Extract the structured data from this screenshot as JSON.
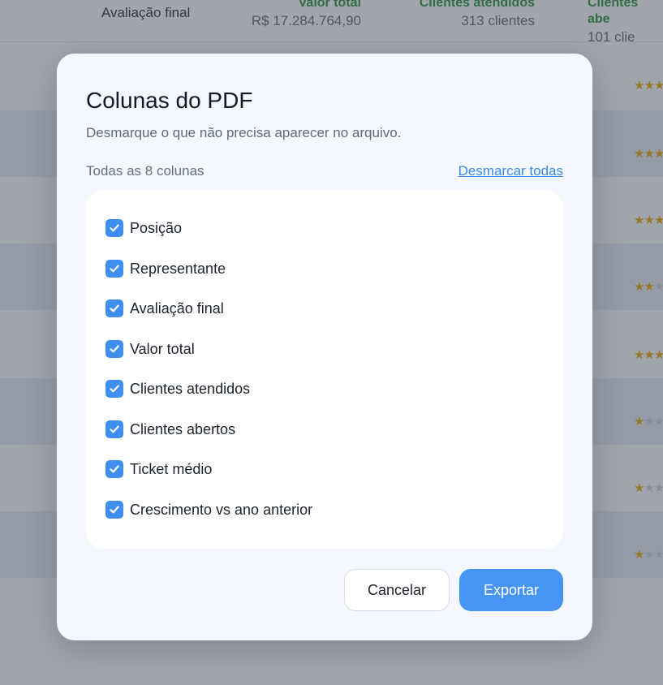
{
  "background_table": {
    "header": {
      "title": "Avaliação final",
      "columns": [
        {
          "label": "Valor total",
          "value": "R$ 17.284.764,90"
        },
        {
          "label": "Clientes atendidos",
          "value": "313 clientes"
        },
        {
          "label": "Clientes abe",
          "value": "101 clie"
        }
      ]
    },
    "rows": [
      {
        "stars": 3
      },
      {
        "stars": 3
      },
      {
        "stars": 3
      },
      {
        "stars": 2
      },
      {
        "stars": 3
      },
      {
        "stars": 1
      },
      {
        "stars": 1
      },
      {
        "stars": 1
      }
    ]
  },
  "modal": {
    "title": "Colunas do PDF",
    "subtitle": "Desmarque o que não precisa aparecer no arquivo.",
    "count_label": "Todas as 8 colunas",
    "uncheck_all_label": "Desmarcar todas",
    "columns": [
      {
        "label": "Posição",
        "checked": true
      },
      {
        "label": "Representante",
        "checked": true
      },
      {
        "label": "Avaliação final",
        "checked": true
      },
      {
        "label": "Valor total",
        "checked": true
      },
      {
        "label": "Clientes atendidos",
        "checked": true
      },
      {
        "label": "Clientes abertos",
        "checked": true
      },
      {
        "label": "Ticket médio",
        "checked": true
      },
      {
        "label": "Crescimento vs ano anterior",
        "checked": true
      }
    ],
    "cancel_label": "Cancelar",
    "export_label": "Exportar"
  },
  "colors": {
    "accent": "#4795f2",
    "checkbox": "#3f8ff0",
    "link": "#3b8be6",
    "header_green": "#1f8a3a",
    "star": "#e0a100"
  },
  "icons": {
    "checkbox": "check-icon",
    "rating": "star-icon"
  }
}
